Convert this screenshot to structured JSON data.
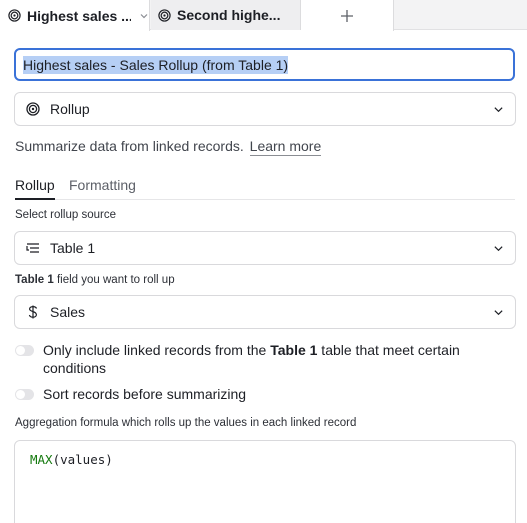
{
  "tabs": [
    {
      "label": "Highest sales ...",
      "icon": "rollup-icon",
      "active": true
    },
    {
      "label": "Second highe...",
      "icon": "rollup-icon",
      "active": false
    }
  ],
  "add_tab_label": "+",
  "field_name": "Highest sales - Sales Rollup (from Table 1)",
  "field_type": {
    "label": "Rollup",
    "icon": "rollup-icon"
  },
  "description": {
    "text": "Summarize data from linked records.",
    "link": "Learn more"
  },
  "subtabs": [
    {
      "label": "Rollup",
      "active": true
    },
    {
      "label": "Formatting",
      "active": false
    }
  ],
  "rollup_source": {
    "label": "Select rollup source",
    "value": "Table 1",
    "icon": "linked-table-icon"
  },
  "rollup_field": {
    "label_table": "Table 1",
    "label_rest": " field you want to roll up",
    "value": "Sales",
    "icon": "dollar-icon"
  },
  "toggles": [
    {
      "pre": "Only include linked records from the ",
      "bold": "Table 1",
      "post": " table that meet certain conditions",
      "on": false
    },
    {
      "pre": "Sort records before summarizing",
      "bold": "",
      "post": "",
      "on": false
    }
  ],
  "aggregation": {
    "label": "Aggregation formula which rolls up the values in each linked record",
    "function": "MAX",
    "args": "(values)"
  },
  "colors": {
    "accent": "#3a72d8",
    "selection": "#b6cff5",
    "formula_function": "#157a0f"
  }
}
